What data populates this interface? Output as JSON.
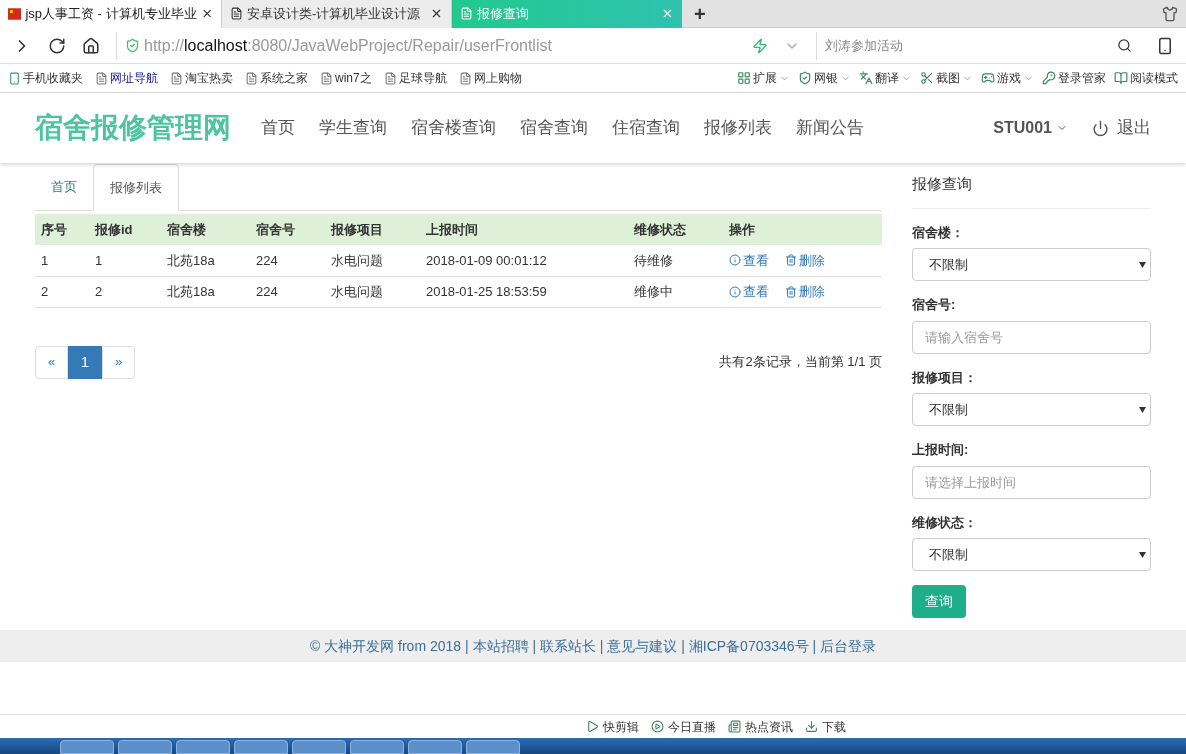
{
  "browser": {
    "tabs": [
      {
        "title": "jsp人事工资 - 计算机专业毕业",
        "selected": false,
        "kind": "flag"
      },
      {
        "title": "安卓设计类-计算机毕业设计源",
        "selected": false,
        "kind": "page"
      },
      {
        "title": "报修查询",
        "selected": true,
        "kind": "page"
      }
    ],
    "new_tab": "+",
    "address": {
      "scheme": "http://",
      "host": "localhost",
      "path": ":8080/JavaWebProject/Repair/userFrontlist"
    },
    "search": {
      "placeholder": "刘涛参加活动"
    },
    "bookmarks": [
      {
        "label": "手机收藏夹",
        "kind": "phone"
      },
      {
        "label": "网址导航",
        "kind": "page"
      },
      {
        "label": "淘宝热卖",
        "kind": "page"
      },
      {
        "label": "系统之家",
        "kind": "page"
      },
      {
        "label": "win7之",
        "kind": "page"
      },
      {
        "label": "足球导航",
        "kind": "page"
      },
      {
        "label": "网上购物",
        "kind": "page"
      }
    ],
    "tools": [
      {
        "label": "扩展",
        "menu": true
      },
      {
        "label": "网银",
        "menu": true
      },
      {
        "label": "翻译",
        "menu": true
      },
      {
        "label": "截图",
        "menu": true
      },
      {
        "label": "游戏",
        "menu": true
      },
      {
        "label": "登录管家",
        "menu": false
      },
      {
        "label": "阅读模式",
        "menu": false
      }
    ]
  },
  "site": {
    "logo": "宿舍报修管理网",
    "nav": [
      {
        "label": "首页"
      },
      {
        "label": "学生查询"
      },
      {
        "label": "宿舍楼查询"
      },
      {
        "label": "宿舍查询"
      },
      {
        "label": "住宿查询"
      },
      {
        "label": "报修列表"
      },
      {
        "label": "新闻公告"
      }
    ],
    "user": "STU001",
    "logout": "退出"
  },
  "breadcrumb_tabs": [
    {
      "label": "首页",
      "selected": false
    },
    {
      "label": "报修列表",
      "selected": true
    }
  ],
  "table": {
    "columns": [
      "序号",
      "报修id",
      "宿舍楼",
      "宿舍号",
      "报修项目",
      "上报时间",
      "维修状态",
      "操作"
    ],
    "rows": [
      {
        "cells": [
          "1",
          "1",
          "北苑18a",
          "224",
          "水电问题",
          "2018-01-09 00:01:12",
          "待维修"
        ],
        "view": "查看",
        "delete": "删除"
      },
      {
        "cells": [
          "2",
          "2",
          "北苑18a",
          "224",
          "水电问题",
          "2018-01-25 18:53:59",
          "维修中"
        ],
        "view": "查看",
        "delete": "删除"
      }
    ]
  },
  "pagination": {
    "prev": "«",
    "pages": [
      {
        "label": "1",
        "selected": true
      }
    ],
    "next": "»",
    "summary": "共有2条记录，当前第 1/1 页"
  },
  "search_panel": {
    "title": "报修查询",
    "fields": [
      {
        "label": "宿舍楼：",
        "kind": "select",
        "value": "不限制"
      },
      {
        "label": "宿舍号:",
        "kind": "input",
        "placeholder": "请输入宿舍号"
      },
      {
        "label": "报修项目：",
        "kind": "select",
        "value": "不限制"
      },
      {
        "label": "上报时间:",
        "kind": "input",
        "placeholder": "请选择上报时间"
      },
      {
        "label": "维修状态：",
        "kind": "select",
        "value": "不限制"
      }
    ],
    "button": "查询"
  },
  "footer": "© 大神开发网 from 2018 | 本站招聘 | 联系站长 | 意见与建议 | 湘ICP备0703346号 | 后台登录",
  "status_bar": [
    {
      "label": "快剪辑"
    },
    {
      "label": "今日直播"
    },
    {
      "label": "热点资讯"
    },
    {
      "label": "下载"
    }
  ]
}
